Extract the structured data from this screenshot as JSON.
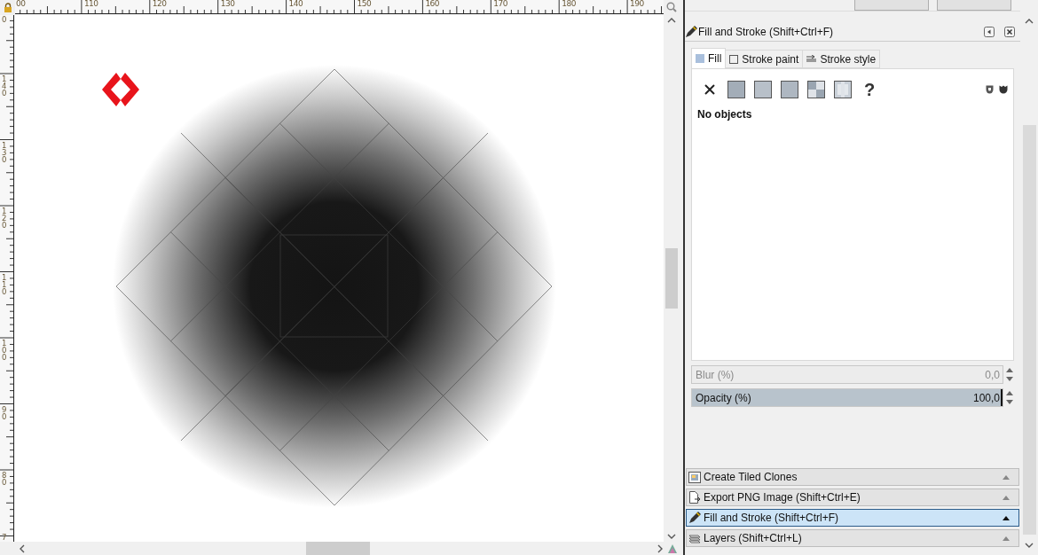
{
  "rulers": {
    "top_labels": [
      "00",
      "110",
      "120",
      "130",
      "140",
      "150",
      "160",
      "170",
      "180",
      "190"
    ],
    "left_labels": [
      "0",
      "140",
      "130",
      "120",
      "110",
      "100",
      "90",
      "80",
      "7"
    ]
  },
  "dialog": {
    "title": "Fill and Stroke (Shift+Ctrl+F)",
    "tabs": [
      {
        "label": "Fill",
        "kind": "fill",
        "selected": true
      },
      {
        "label": "Stroke paint",
        "kind": "stroke-paint",
        "selected": false
      },
      {
        "label": "Stroke style",
        "kind": "stroke-style",
        "selected": false
      }
    ],
    "paint_modes": [
      {
        "kind": "none"
      },
      {
        "kind": "flat"
      },
      {
        "kind": "linear"
      },
      {
        "kind": "radial"
      },
      {
        "kind": "pattern"
      },
      {
        "kind": "swatch"
      },
      {
        "kind": "unset",
        "symbol": "?"
      }
    ],
    "status": "No objects",
    "sliders": [
      {
        "label": "Blur (%)",
        "value": "0,0",
        "disabled": true
      },
      {
        "label": "Opacity (%)",
        "value": "100,0",
        "disabled": false,
        "level": 1
      }
    ]
  },
  "docked_dialogs": [
    {
      "label": "Create Tiled Clones",
      "kind": "tiled-clones",
      "selected": false
    },
    {
      "label": "Export PNG Image (Shift+Ctrl+E)",
      "kind": "export",
      "selected": false
    },
    {
      "label": "Fill and Stroke (Shift+Ctrl+F)",
      "kind": "fill-stroke",
      "selected": true
    },
    {
      "label": "Layers (Shift+Ctrl+L)",
      "kind": "layers",
      "selected": false
    }
  ]
}
